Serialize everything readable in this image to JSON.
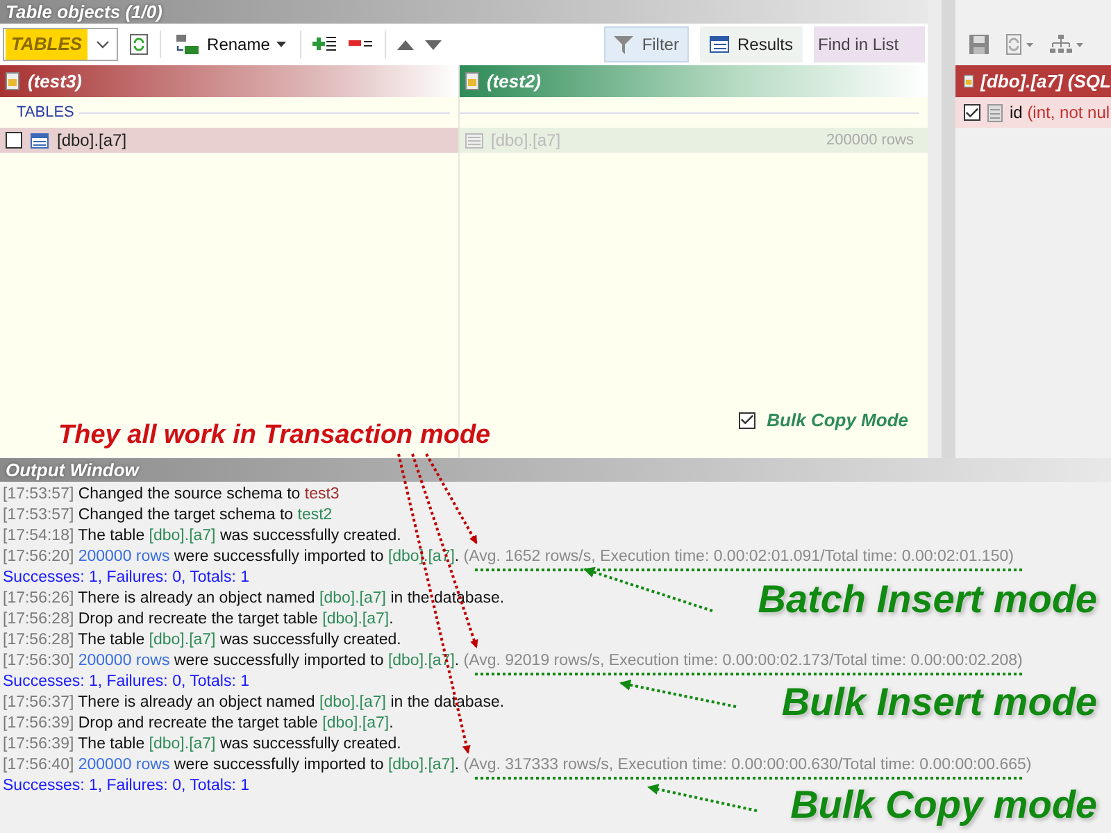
{
  "panel_title": "Table objects (1/0)",
  "toolbar": {
    "type_dropdown": "TABLES",
    "rename": "Rename",
    "tools": [
      {
        "label": "Filter",
        "kind": "filter",
        "selected": true
      },
      {
        "label": "Results",
        "kind": "results",
        "selected": false
      }
    ],
    "find": {
      "placeholder": "Find in List"
    }
  },
  "source": {
    "schema": "(test3)",
    "group": "TABLES",
    "items": [
      {
        "name": "[dbo].[a7]",
        "checked": false
      }
    ]
  },
  "target": {
    "schema": "(test2)",
    "items": [
      {
        "name": "[dbo].[a7]",
        "rows": "200000 rows"
      }
    ]
  },
  "bulk_copy": {
    "label": "Bulk Copy Mode",
    "checked": true
  },
  "details": {
    "title": "[dbo].[a7] (SQL",
    "columns": [
      {
        "name": "id",
        "type": "(int, not nul",
        "checked": true
      }
    ]
  },
  "output": {
    "title": "Output Window",
    "lines": [
      {
        "segments": [
          {
            "kind": "time",
            "text": "[17:53:57]"
          },
          {
            "kind": "text",
            "text": " Changed the source schema to "
          },
          {
            "kind": "source",
            "text": "test3"
          }
        ]
      },
      {
        "segments": [
          {
            "kind": "time",
            "text": "[17:53:57]"
          },
          {
            "kind": "text",
            "text": " Changed the target schema to "
          },
          {
            "kind": "object",
            "text": "test2"
          }
        ]
      },
      {
        "segments": [
          {
            "kind": "time",
            "text": "[17:54:18]"
          },
          {
            "kind": "text",
            "text": " The table "
          },
          {
            "kind": "object",
            "text": "[dbo].[a7]"
          },
          {
            "kind": "text",
            "text": " was successfully created."
          }
        ]
      },
      {
        "segments": [
          {
            "kind": "time",
            "text": "[17:56:20]"
          },
          {
            "kind": "count",
            "text": " 200000 rows"
          },
          {
            "kind": "text",
            "text": " were successfully imported to "
          },
          {
            "kind": "object",
            "text": "[dbo].[a7]"
          },
          {
            "kind": "text",
            "text": ". "
          },
          {
            "kind": "stats",
            "text": "(Avg. 1652 rows/s, Execution time: 0.00:02:01.091/Total time: 0.00:02:01.150)"
          }
        ]
      },
      {
        "segments": [
          {
            "kind": "summary",
            "text": "Successes: 1, Failures: 0, Totals: 1"
          }
        ]
      },
      {
        "segments": [
          {
            "kind": "time",
            "text": "[17:56:26]"
          },
          {
            "kind": "text",
            "text": " There is already an object named "
          },
          {
            "kind": "object",
            "text": "[dbo].[a7]"
          },
          {
            "kind": "text",
            "text": " in the database."
          }
        ]
      },
      {
        "segments": [
          {
            "kind": "time",
            "text": "[17:56:28]"
          },
          {
            "kind": "text",
            "text": " Drop and recreate the target table "
          },
          {
            "kind": "object",
            "text": "[dbo].[a7]"
          },
          {
            "kind": "text",
            "text": "."
          }
        ]
      },
      {
        "segments": [
          {
            "kind": "time",
            "text": "[17:56:28]"
          },
          {
            "kind": "text",
            "text": " The table "
          },
          {
            "kind": "object",
            "text": "[dbo].[a7]"
          },
          {
            "kind": "text",
            "text": " was successfully created."
          }
        ]
      },
      {
        "segments": [
          {
            "kind": "time",
            "text": "[17:56:30]"
          },
          {
            "kind": "count",
            "text": " 200000 rows"
          },
          {
            "kind": "text",
            "text": " were successfully imported to "
          },
          {
            "kind": "object",
            "text": "[dbo].[a7]"
          },
          {
            "kind": "text",
            "text": ". "
          },
          {
            "kind": "stats",
            "text": "(Avg. 92019 rows/s, Execution time: 0.00:00:02.173/Total time: 0.00:00:02.208)"
          }
        ]
      },
      {
        "segments": [
          {
            "kind": "summary",
            "text": "Successes: 1, Failures: 0, Totals: 1"
          }
        ]
      },
      {
        "segments": [
          {
            "kind": "time",
            "text": "[17:56:37]"
          },
          {
            "kind": "text",
            "text": " There is already an object named "
          },
          {
            "kind": "object",
            "text": "[dbo].[a7]"
          },
          {
            "kind": "text",
            "text": " in the database."
          }
        ]
      },
      {
        "segments": [
          {
            "kind": "time",
            "text": "[17:56:39]"
          },
          {
            "kind": "text",
            "text": " Drop and recreate the target table "
          },
          {
            "kind": "object",
            "text": "[dbo].[a7]"
          },
          {
            "kind": "text",
            "text": "."
          }
        ]
      },
      {
        "segments": [
          {
            "kind": "time",
            "text": "[17:56:39]"
          },
          {
            "kind": "text",
            "text": " The table "
          },
          {
            "kind": "object",
            "text": "[dbo].[a7]"
          },
          {
            "kind": "text",
            "text": " was successfully created."
          }
        ]
      },
      {
        "segments": [
          {
            "kind": "time",
            "text": "[17:56:40]"
          },
          {
            "kind": "count",
            "text": " 200000 rows"
          },
          {
            "kind": "text",
            "text": " were successfully imported to "
          },
          {
            "kind": "object",
            "text": "[dbo].[a7]"
          },
          {
            "kind": "text",
            "text": ". "
          },
          {
            "kind": "stats",
            "text": "(Avg. 317333 rows/s, Execution time: 0.00:00:00.630/Total time: 0.00:00:00.665)"
          }
        ]
      },
      {
        "segments": [
          {
            "kind": "summary",
            "text": "Successes: 1, Failures: 0, Totals: 1"
          }
        ]
      }
    ]
  },
  "annotations": {
    "note": "They all work in Transaction mode",
    "labels": [
      "Batch Insert mode",
      "Bulk Insert mode",
      "Bulk Copy mode"
    ]
  }
}
